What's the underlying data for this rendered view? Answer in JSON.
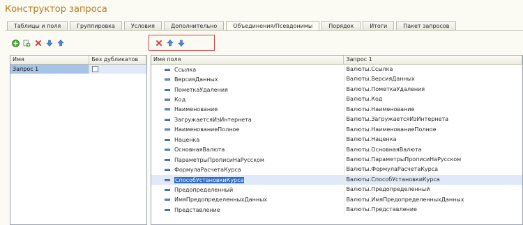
{
  "window": {
    "title": "Конструктор запроса"
  },
  "tabs": [
    {
      "label": "Таблицы и поля",
      "active": false
    },
    {
      "label": "Группировка",
      "active": false
    },
    {
      "label": "Условия",
      "active": false
    },
    {
      "label": "Дополнительно",
      "active": false
    },
    {
      "label": "Объединения/Псевдонимы",
      "active": true
    },
    {
      "label": "Порядок",
      "active": false
    },
    {
      "label": "Итоги",
      "active": false
    },
    {
      "label": "Пакет запросов",
      "active": false
    }
  ],
  "left_toolbar": {
    "buttons": [
      "add-icon",
      "copy-icon",
      "delete-icon",
      "move-down-icon",
      "move-up-icon"
    ]
  },
  "right_toolbar": {
    "buttons": [
      "delete-icon",
      "move-up-icon",
      "move-down-icon"
    ]
  },
  "queries_table": {
    "headers": {
      "name": "Имя",
      "no_duplicates": "Без дубликатов"
    },
    "rows": [
      {
        "name": "Запрос 1",
        "no_duplicates": false,
        "selected": true
      }
    ]
  },
  "fields_table": {
    "headers": {
      "field_name": "Имя поля",
      "query1": "Запрос 1"
    },
    "rows": [
      {
        "field": "Ссылка",
        "query1": "Валюты.Ссылка"
      },
      {
        "field": "ВерсияДанных",
        "query1": "Валюты.ВерсияДанных"
      },
      {
        "field": "ПометкаУдаления",
        "query1": "Валюты.ПометкаУдаления"
      },
      {
        "field": "Код",
        "query1": "Валюты.Код"
      },
      {
        "field": "Наименование",
        "query1": "Валюты.Наименование"
      },
      {
        "field": "ЗагружаетсяИзИнтернета",
        "query1": "Валюты.ЗагружаетсяИзИнтернета"
      },
      {
        "field": "НаименованиеПолное",
        "query1": "Валюты.НаименованиеПолное"
      },
      {
        "field": "Наценка",
        "query1": "Валюты.Наценка"
      },
      {
        "field": "ОсновнаяВалюта",
        "query1": "Валюты.ОсновнаяВалюта"
      },
      {
        "field": "ПараметрыПрописиНаРусском",
        "query1": "Валюты.ПараметрыПрописиНаРусском"
      },
      {
        "field": "ФормулаРасчетаКурса",
        "query1": "Валюты.ФормулаРасчетаКурса"
      },
      {
        "field": "СпособУстановкиКурса",
        "query1": "Валюты.СпособУстановкиКурса",
        "selected": true
      },
      {
        "field": "Предопределенный",
        "query1": "Валюты.Предопределенный"
      },
      {
        "field": "ИмяПредопределенныхДанных",
        "query1": "Валюты.ИмяПредопределенныхДанных"
      },
      {
        "field": "Представление",
        "query1": "Валюты.Представление"
      }
    ]
  },
  "colors": {
    "title": "#b87a1c",
    "selection": "#3169c6",
    "highlight_box": "#d83a3a"
  }
}
